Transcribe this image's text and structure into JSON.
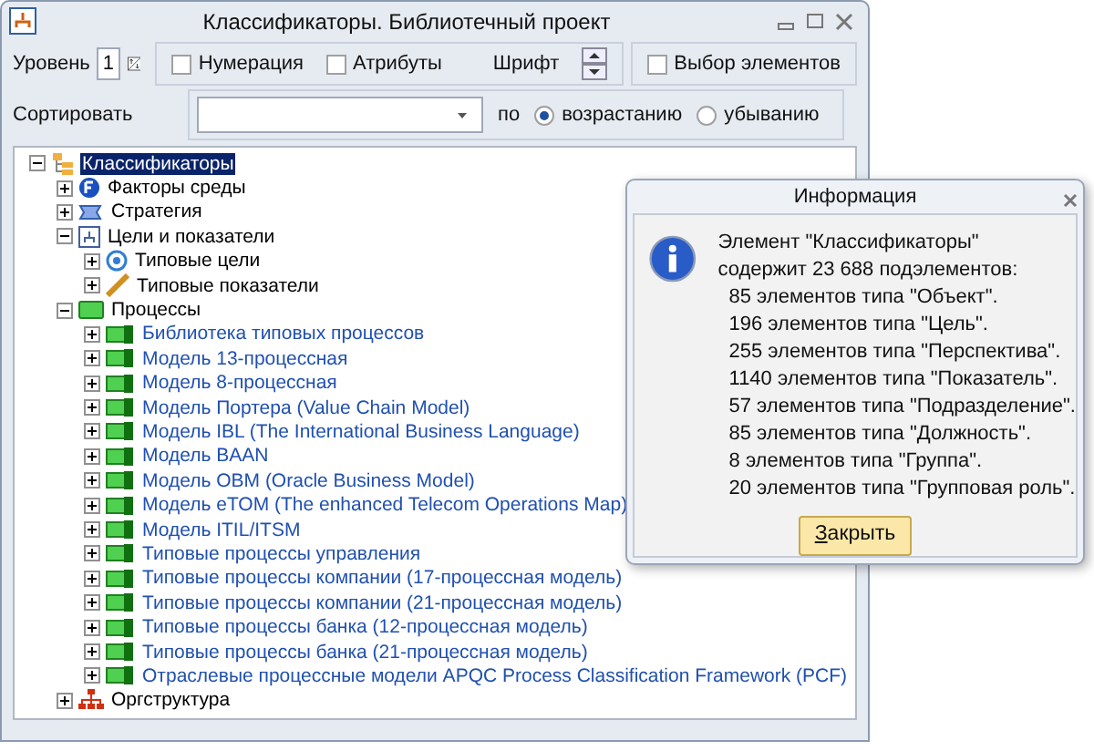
{
  "window": {
    "title": "Классификаторы. Библиотечный проект"
  },
  "toolbar": {
    "level_label": "Уровень",
    "level_value": "1",
    "checkboxes": [
      {
        "label": "Нумерация",
        "checked": false
      },
      {
        "label": "Атрибуты",
        "checked": false
      }
    ],
    "font_label": "Шрифт",
    "select_elements": {
      "label": "Выбор элементов",
      "checked": false
    },
    "sort_label": "Сортировать",
    "by_label": "по",
    "order": [
      {
        "label": "возрастанию",
        "selected": true
      },
      {
        "label": "убыванию",
        "selected": false
      }
    ]
  },
  "tree": [
    {
      "label": "Классификаторы",
      "kind": "root",
      "expanded": true,
      "selected": true,
      "children": [
        {
          "label": "Факторы среды",
          "kind": "factor",
          "expanded": false,
          "selected": false
        },
        {
          "label": "Стратегия",
          "kind": "strategy",
          "expanded": false,
          "selected": false
        },
        {
          "label": "Цели и показатели",
          "kind": "goals",
          "expanded": true,
          "selected": false,
          "children": [
            {
              "label": "Типовые цели",
              "kind": "goal",
              "expanded": false,
              "selected": false
            },
            {
              "label": "Типовые показатели",
              "kind": "indicator",
              "expanded": false,
              "selected": false
            }
          ]
        },
        {
          "label": "Процессы",
          "kind": "processes",
          "expanded": true,
          "selected": false,
          "children": [
            {
              "label": "Библиотека типовых процессов",
              "kind": "model",
              "expanded": false,
              "selected": false
            },
            {
              "label": "Модель 13-процессная",
              "kind": "model",
              "expanded": false,
              "selected": false
            },
            {
              "label": "Модель 8-процессная",
              "kind": "model",
              "expanded": false,
              "selected": false
            },
            {
              "label": "Модель Портера (Value Chain Model)",
              "kind": "model",
              "expanded": false,
              "selected": false
            },
            {
              "label": "Модель IBL (The International Business Language)",
              "kind": "model",
              "expanded": false,
              "selected": false
            },
            {
              "label": "Модель BAAN",
              "kind": "model",
              "expanded": false,
              "selected": false
            },
            {
              "label": "Модель OBM (Oracle Business Model)",
              "kind": "model",
              "expanded": false,
              "selected": false
            },
            {
              "label": "Модель eTOM (The enhanced Telecom Operations Map)",
              "kind": "model",
              "expanded": false,
              "selected": false
            },
            {
              "label": "Модель ITIL/ITSM",
              "kind": "model",
              "expanded": false,
              "selected": false
            },
            {
              "label": "Типовые процессы управления",
              "kind": "model",
              "expanded": false,
              "selected": false
            },
            {
              "label": "Типовые процессы компании (17-процессная модель)",
              "kind": "model",
              "expanded": false,
              "selected": false
            },
            {
              "label": "Типовые процессы компании (21-процессная модель)",
              "kind": "model",
              "expanded": false,
              "selected": false
            },
            {
              "label": "Типовые процессы банка (12-процессная модель)",
              "kind": "model",
              "expanded": false,
              "selected": false
            },
            {
              "label": "Типовые процессы банка (21-процессная модель)",
              "kind": "model",
              "expanded": false,
              "selected": false
            },
            {
              "label": "Отраслевые процессные модели APQC Process Classification Framework (PCF)",
              "kind": "model",
              "expanded": false,
              "selected": false
            }
          ]
        },
        {
          "label": "Оргструктура",
          "kind": "org",
          "expanded": false,
          "selected": false
        }
      ]
    }
  ],
  "dialog": {
    "title": "Информация",
    "heading": [
      "Элемент \"Классификаторы\"",
      "содержит 23 688 подэлементов:"
    ],
    "lines": [
      "85 элементов типа \"Объект\".",
      "196 элементов типа \"Цель\".",
      "255 элементов типа \"Перспектива\".",
      "1140 элементов типа \"Показатель\".",
      "57 элементов типа \"Подразделение\".",
      "85 элементов типа \"Должность\".",
      "8 элементов типа \"Группа\".",
      "20 элементов типа \"Групповая роль\"."
    ],
    "button": "Закрыть"
  }
}
